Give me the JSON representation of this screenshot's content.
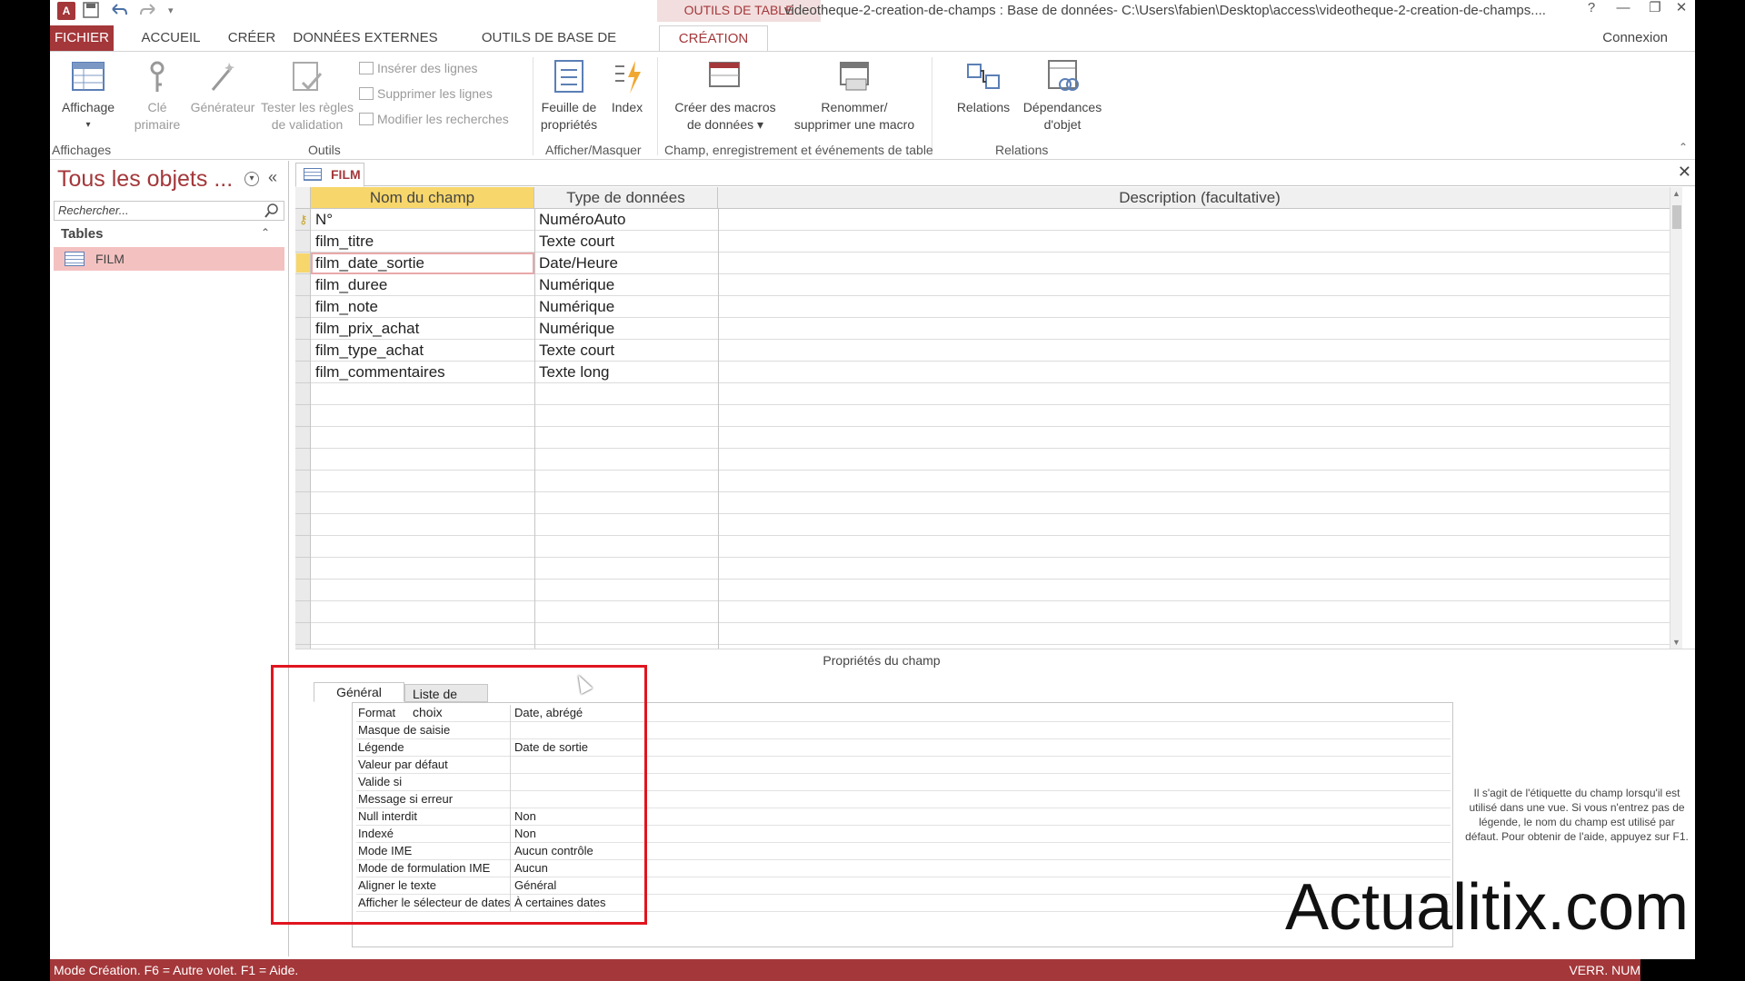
{
  "title_bar": {
    "app_logo": "A",
    "context_tab_group": "OUTILS DE TABLE",
    "window_title": "videotheque-2-creation-de-champs : Base de données- C:\\Users\\fabien\\Desktop\\access\\videotheque-2-creation-de-champs....",
    "help": "?",
    "minimize": "—",
    "restore": "❐",
    "close": "✕"
  },
  "ribbon_tabs": [
    "FICHIER",
    "ACCUEIL",
    "CRÉER",
    "DONNÉES EXTERNES",
    "OUTILS DE BASE DE DONNÉES",
    "CRÉATION"
  ],
  "connexion": "Connexion",
  "ribbon": {
    "affichage": "Affichage",
    "cle_primaire_1": "Clé",
    "cle_primaire_2": "primaire",
    "generateur": "Générateur",
    "tester_1": "Tester les règles",
    "tester_2": "de validation",
    "inserer_lignes": "Insérer des lignes",
    "supprimer_lignes": "Supprimer les lignes",
    "modifier_recherches": "Modifier les recherches",
    "feuille_1": "Feuille de",
    "feuille_2": "propriétés",
    "index": "Index",
    "macros_1": "Créer des macros",
    "macros_2": "de données ▾",
    "renommer_1": "Renommer/",
    "renommer_2": "supprimer une macro",
    "relations": "Relations",
    "dependances_1": "Dépendances",
    "dependances_2": "d'objet",
    "groups": {
      "affichages": "Affichages",
      "outils": "Outils",
      "afficher_masquer": "Afficher/Masquer",
      "champ": "Champ, enregistrement et événements de table",
      "relations": "Relations"
    }
  },
  "nav": {
    "title": "Tous les objets ...",
    "search_placeholder": "Rechercher...",
    "group": "Tables",
    "items": [
      "FILM"
    ]
  },
  "document": {
    "tab": "FILM",
    "columns": [
      "Nom du champ",
      "Type de données",
      "Description (facultative)"
    ],
    "fields": [
      {
        "name": "N°",
        "type": "NuméroAuto",
        "primary_key": true
      },
      {
        "name": "film_titre",
        "type": "Texte court"
      },
      {
        "name": "film_date_sortie",
        "type": "Date/Heure",
        "active": true
      },
      {
        "name": "film_duree",
        "type": "Numérique"
      },
      {
        "name": "film_note",
        "type": "Numérique"
      },
      {
        "name": "film_prix_achat",
        "type": "Numérique"
      },
      {
        "name": "film_type_achat",
        "type": "Texte court"
      },
      {
        "name": "film_commentaires",
        "type": "Texte long"
      }
    ]
  },
  "properties": {
    "title": "Propriétés du champ",
    "tabs": [
      "Général",
      "Liste de choix"
    ],
    "rows": [
      {
        "label": "Format",
        "value": "Date, abrégé"
      },
      {
        "label": "Masque de saisie",
        "value": ""
      },
      {
        "label": "Légende",
        "value": "Date de sortie"
      },
      {
        "label": "Valeur par défaut",
        "value": ""
      },
      {
        "label": "Valide si",
        "value": ""
      },
      {
        "label": "Message si erreur",
        "value": ""
      },
      {
        "label": "Null interdit",
        "value": "Non"
      },
      {
        "label": "Indexé",
        "value": "Non"
      },
      {
        "label": "Mode IME",
        "value": "Aucun contrôle"
      },
      {
        "label": "Mode de formulation IME",
        "value": "Aucun"
      },
      {
        "label": "Aligner le texte",
        "value": "Général"
      },
      {
        "label": "Afficher le sélecteur de dates",
        "value": "À certaines dates"
      }
    ],
    "help": "Il s'agit de l'étiquette du champ lorsqu'il est utilisé dans une vue. Si vous n'entrez pas de légende, le nom du champ est utilisé par défaut. Pour obtenir de l'aide, appuyez sur F1."
  },
  "status": {
    "left": "Mode Création. F6 = Autre volet. F1 = Aide.",
    "right": "VERR. NUM"
  },
  "watermark": "Actualitix.com",
  "colors": {
    "accent": "#a4373a",
    "highlight_box": "#e0151f",
    "header_selected": "#f7d66b",
    "nav_selected": "#f4c1c1"
  }
}
